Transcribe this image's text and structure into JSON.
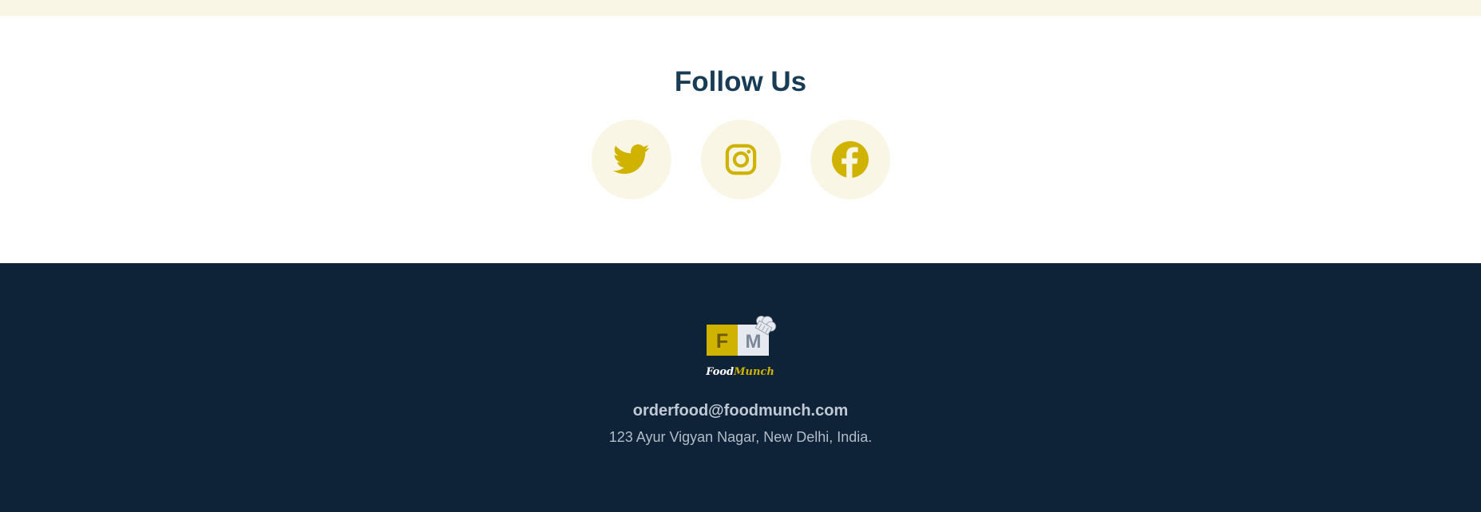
{
  "follow": {
    "title": "Follow Us",
    "social": [
      {
        "icon": "twitter-icon"
      },
      {
        "icon": "instagram-icon"
      },
      {
        "icon": "facebook-icon"
      }
    ]
  },
  "footer": {
    "logo": {
      "food": "Food",
      "munch": "Munch"
    },
    "email": "orderfood@foodmunch.com",
    "address": "123 Ayur Vigyan Nagar, New Delhi, India."
  },
  "colors": {
    "accent": "#d0b200",
    "heading": "#183b56",
    "icon_bg": "#f9f6e6",
    "footer_bg": "#0e2337"
  }
}
